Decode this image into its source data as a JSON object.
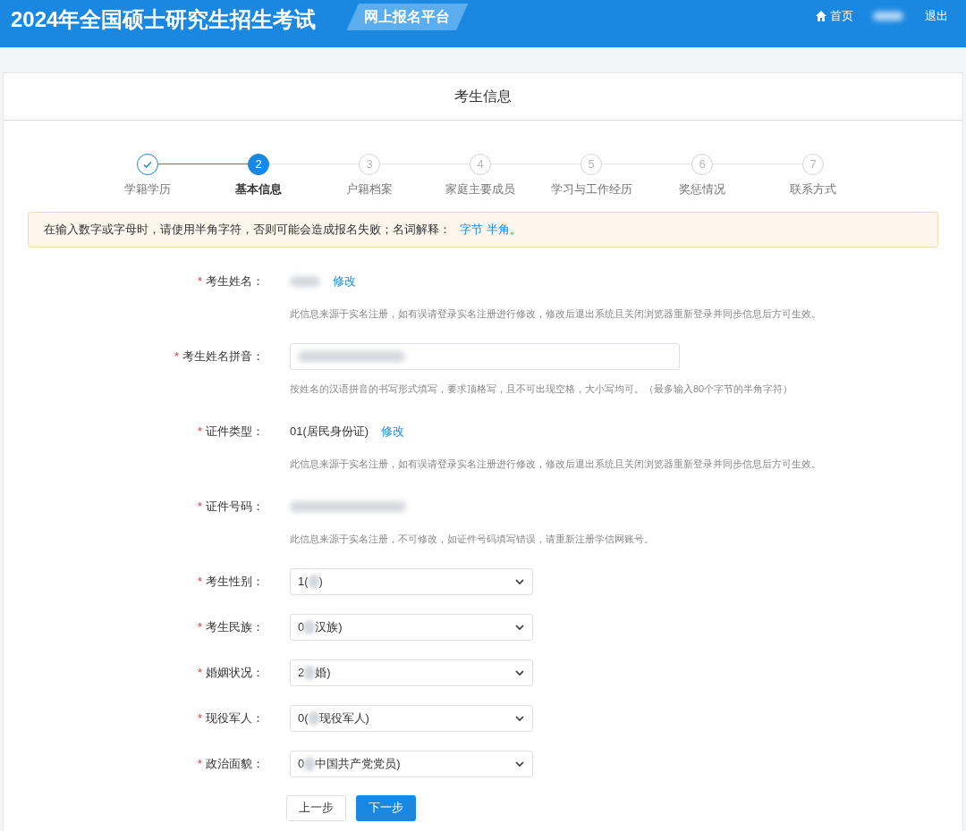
{
  "header": {
    "title": "2024年全国硕士研究生招生考试",
    "platform": "网上报名平台",
    "nav": [
      {
        "kind": "home",
        "label": "首页"
      },
      {
        "kind": "user"
      },
      {
        "kind": "link",
        "label": "退出"
      }
    ]
  },
  "card_title": "考生信息",
  "steps": [
    {
      "label": "学籍学历",
      "done": true,
      "selected": false
    },
    {
      "number": "2",
      "label": "基本信息",
      "done": false,
      "selected": true
    },
    {
      "number": "3",
      "label": "户籍档案",
      "done": false,
      "selected": false
    },
    {
      "number": "4",
      "label": "家庭主要成员",
      "done": false,
      "selected": false
    },
    {
      "number": "5",
      "label": "学习与工作经历",
      "done": false,
      "selected": false
    },
    {
      "number": "6",
      "label": "奖惩情况",
      "done": false,
      "selected": false
    },
    {
      "number": "7",
      "label": "联系方式",
      "done": false,
      "selected": false
    }
  ],
  "required_mark": "*",
  "notice": {
    "text": "在输入数字或字母时，请使用半角字符，否则可能会造成报名失败；名词解释：",
    "links": [
      "字节",
      "半角"
    ],
    "end": "。"
  },
  "fields": [
    {
      "kind": "text",
      "label": "考生姓名：",
      "required": true,
      "blurred": true,
      "action": "修改",
      "hint": "此信息来源于实名注册，如有误请登录实名注册进行修改，修改后退出系统且关闭浏览器重新登录并同步信息后方可生效。"
    },
    {
      "kind": "input",
      "label": "考生姓名拼音：",
      "required": true,
      "blurred": true,
      "hint": "按姓名的汉语拼音的书写形式填写，要求顶格写，且不可出现空格，大小写均可。（最多输入80个字节的半角字符）"
    },
    {
      "kind": "text",
      "label": "证件类型：",
      "required": true,
      "value": "01(居民身份证)",
      "action": "修改",
      "hint": "此信息来源于实名注册，如有误请登录实名注册进行修改，修改后退出系统且关闭浏览器重新登录并同步信息后方可生效。"
    },
    {
      "kind": "text",
      "label": "证件号码：",
      "required": true,
      "blurred": true,
      "hint": "此信息来源于实名注册，不可修改，如证件号码填写错误，请重新注册学信网账号。"
    },
    {
      "kind": "select",
      "label": "考生性别：",
      "required": true,
      "value_start": "1(",
      "value_end": ")"
    },
    {
      "kind": "select",
      "label": "考生民族：",
      "required": true,
      "value_start": "0",
      "value_end": "汉族)"
    },
    {
      "kind": "select",
      "label": "婚姻状况：",
      "required": true,
      "value_start": "2",
      "value_end": "婚)"
    },
    {
      "kind": "select",
      "label": "现役军人：",
      "required": true,
      "value_start": "0(",
      "value_end": "现役军人)"
    },
    {
      "kind": "select",
      "label": "政治面貌：",
      "required": true,
      "value_start": "0",
      "value_end": "中国共产党党员)"
    }
  ],
  "buttons": [
    {
      "kind": "secondary",
      "label": "上一步"
    },
    {
      "kind": "primary",
      "label": "下一步"
    }
  ]
}
